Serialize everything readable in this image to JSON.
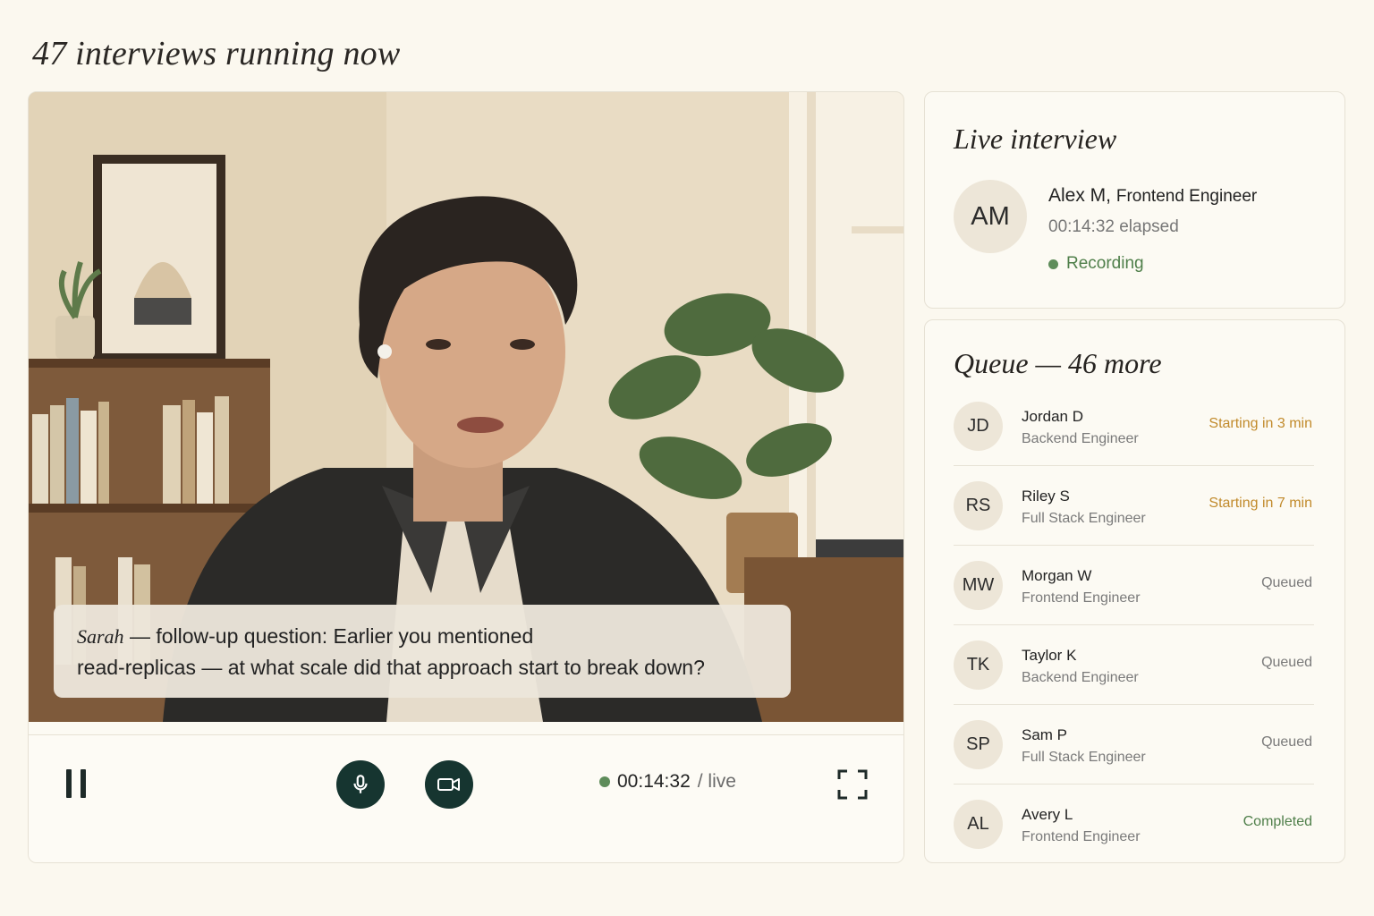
{
  "page": {
    "title": "47 interviews running now"
  },
  "video": {
    "caption": {
      "speaker": "Sarah",
      "separator": " — ",
      "line1": "follow-up question: Earlier you mentioned",
      "line2": "read-replicas — at what scale did that approach start to break down?"
    },
    "controls": {
      "pause_icon": "pause-icon",
      "mic_icon": "microphone-icon",
      "camera_icon": "video-camera-icon",
      "fullscreen_icon": "fullscreen-icon",
      "timer": "00:14:32",
      "timer_suffix": "/ live",
      "accent": "#163530"
    }
  },
  "live_interview": {
    "title": "Live interview",
    "initials": "AM",
    "name": "Alex M,",
    "role": "Frontend Engineer",
    "elapsed": "00:14:32 elapsed",
    "status": "Recording",
    "status_color": "#4f7f4a"
  },
  "queue": {
    "title": "Queue — 46 more",
    "items": [
      {
        "initials": "JD",
        "name": "Jordan D",
        "role": "Backend Engineer",
        "status": "Starting in 3 min"
      },
      {
        "initials": "RS",
        "name": "Riley S",
        "role": "Full Stack Engineer",
        "status": "Starting in 7 min"
      },
      {
        "initials": "MW",
        "name": "Morgan W",
        "role": "Frontend Engineer",
        "status": "Queued"
      },
      {
        "initials": "TK",
        "name": "Taylor K",
        "role": "Backend Engineer",
        "status": "Queued"
      },
      {
        "initials": "SP",
        "name": "Sam P",
        "role": "Full Stack Engineer",
        "status": "Queued"
      },
      {
        "initials": "AL",
        "name": "Avery L",
        "role": "Frontend Engineer",
        "status": "Completed"
      }
    ]
  }
}
